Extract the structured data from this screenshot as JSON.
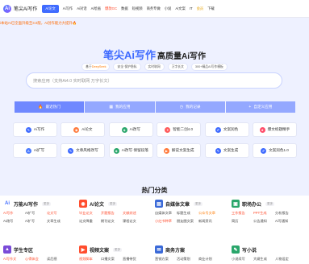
{
  "header": {
    "logo_char": "Ai",
    "site_name": "笔尖Ai写作",
    "nav": [
      {
        "label": "Ai论文",
        "state": "active"
      },
      {
        "label": "Ai写作",
        "state": ""
      },
      {
        "label": "Ai对话",
        "state": ""
      },
      {
        "label": "Ai绘画",
        "state": ""
      },
      {
        "label": "爆款GC",
        "state": "hot"
      },
      {
        "label": "数据",
        "state": ""
      },
      {
        "label": "短视频",
        "state": ""
      },
      {
        "label": "商务专做",
        "state": ""
      },
      {
        "label": "小说",
        "state": ""
      },
      {
        "label": "Ai文案",
        "state": ""
      },
      {
        "label": "IT",
        "state": ""
      },
      {
        "label": "会员",
        "state": "vip"
      },
      {
        "label": "下载",
        "state": ""
      }
    ]
  },
  "notice": "i本站AI已全面升级至3.0版，Ai创作能力大提升🔥",
  "hero": {
    "brand": "笔尖Ai写作",
    "tagline": "高质量Ai写作",
    "features": [
      {
        "pre": "基于",
        "hl": "DeepSeek",
        "post": ""
      },
      {
        "pre": "安全·保护隐私",
        "hl": "",
        "post": ""
      },
      {
        "pre": "实时联网",
        "hl": "",
        "post": ""
      },
      {
        "pre": "万字长文",
        "hl": "",
        "post": ""
      },
      {
        "pre": "300+精品AI写作模板",
        "hl": "",
        "post": ""
      }
    ]
  },
  "search": {
    "placeholder": "搜索应用（支持Ai4.0 实时联网 万字长文）"
  },
  "tabs": [
    {
      "label": "最近热门",
      "icon": "🔥"
    },
    {
      "label": "我的应用",
      "icon": "▦"
    },
    {
      "label": "我的记录",
      "icon": "◷"
    },
    {
      "label": "自定义应用",
      "icon": "+"
    }
  ],
  "tools": [
    {
      "label": "Ai写作",
      "icon": "✎",
      "color": "#3f6bff"
    },
    {
      "label": "Ai论文",
      "icon": "◉",
      "color": "#ff7a3c"
    },
    {
      "label": "Ai改写",
      "icon": "◈",
      "color": "#2aa66b"
    },
    {
      "label": "智能二创4.0",
      "icon": "✦",
      "color": "#ff5b5b"
    },
    {
      "label": "文案润色",
      "icon": "✐",
      "color": "#3f6bff"
    },
    {
      "label": "爆文标题精手",
      "icon": "★",
      "color": "#ff4d6a"
    },
    {
      "label": "Ai扩写",
      "icon": "A",
      "color": "#4b7bff"
    },
    {
      "label": "文章风格改写",
      "icon": "✎",
      "color": "#3f6bff"
    },
    {
      "label": "Ai改写·保留段落",
      "icon": "◈",
      "color": "#2aa66b"
    },
    {
      "label": "解说文案生成",
      "icon": "▶",
      "color": "#ff7a3c"
    },
    {
      "label": "文案生成",
      "icon": "✎",
      "color": "#3f6bff"
    },
    {
      "label": "文案润色1.0",
      "icon": "✐",
      "color": "#3f6bff"
    }
  ],
  "categories_title": "热门分类",
  "categories": [
    {
      "name": "万能AI写作",
      "icon": "Ai",
      "icon_color": "#3f6bff",
      "icon_bg": "#fff",
      "more": "更多",
      "items": [
        {
          "t": "AI写作",
          "c": "red"
        },
        {
          "t": "AI扩写",
          "c": ""
        },
        {
          "t": "论文写",
          "c": "red"
        },
        {
          "t": "AI改写",
          "c": ""
        },
        {
          "t": "Ai扩写",
          "c": ""
        },
        {
          "t": "文章生成",
          "c": ""
        }
      ]
    },
    {
      "name": "AI论文",
      "icon": "◉",
      "icon_color": "#fff",
      "icon_bg": "#ff4d2e",
      "more": "更多",
      "items": [
        {
          "t": "毕业论文",
          "c": "red"
        },
        {
          "t": "开题报告",
          "c": "red"
        },
        {
          "t": "文献综述",
          "c": "red"
        },
        {
          "t": "论文降重",
          "c": ""
        },
        {
          "t": "期刊论文",
          "c": ""
        },
        {
          "t": "课程论文",
          "c": ""
        }
      ]
    },
    {
      "name": "自媒体文章",
      "icon": "▤",
      "icon_color": "#fff",
      "icon_bg": "#3b6ad8",
      "more": "更多",
      "items": [
        {
          "t": "自媒体文章",
          "c": ""
        },
        {
          "t": "标题生成",
          "c": ""
        },
        {
          "t": "公众号文章",
          "c": "orange"
        },
        {
          "t": "小红书种草",
          "c": "red"
        },
        {
          "t": "朋友圈文案",
          "c": ""
        },
        {
          "t": "新闻资讯",
          "c": ""
        }
      ]
    },
    {
      "name": "职场办公",
      "icon": "▣",
      "icon_color": "#fff",
      "icon_bg": "#2aa66b",
      "more": "更多",
      "items": [
        {
          "t": "工作报告",
          "c": "red"
        },
        {
          "t": "PPT生成",
          "c": "red"
        },
        {
          "t": "分析报告",
          "c": ""
        },
        {
          "t": "简历",
          "c": ""
        },
        {
          "t": "公告通知",
          "c": ""
        },
        {
          "t": "Ai写通知",
          "c": ""
        }
      ]
    },
    {
      "name": "学生专区",
      "icon": "▲",
      "icon_color": "#fff",
      "icon_bg": "#7a4bd8",
      "more": "",
      "items": [
        {
          "t": "Ai写作文",
          "c": "red"
        },
        {
          "t": "心得体会",
          "c": "red"
        },
        {
          "t": "读后感",
          "c": ""
        }
      ]
    },
    {
      "name": "视频文案",
      "icon": "▶",
      "icon_color": "#fff",
      "icon_bg": "#ff4d2e",
      "more": "更多",
      "items": [
        {
          "t": "视频脚本",
          "c": "red"
        },
        {
          "t": "口播文案",
          "c": ""
        },
        {
          "t": "直播带货",
          "c": ""
        }
      ]
    },
    {
      "name": "商务方案",
      "icon": "✉",
      "icon_color": "#fff",
      "icon_bg": "#3b6ad8",
      "more": "",
      "items": [
        {
          "t": "营销方案",
          "c": ""
        },
        {
          "t": "活动策划",
          "c": ""
        },
        {
          "t": "商业计划",
          "c": ""
        }
      ]
    },
    {
      "name": "写小说",
      "icon": "✎",
      "icon_color": "#fff",
      "icon_bg": "#2aa66b",
      "more": "",
      "items": [
        {
          "t": "小说续写",
          "c": ""
        },
        {
          "t": "大纲生成",
          "c": ""
        },
        {
          "t": "人物设定",
          "c": ""
        }
      ]
    }
  ]
}
